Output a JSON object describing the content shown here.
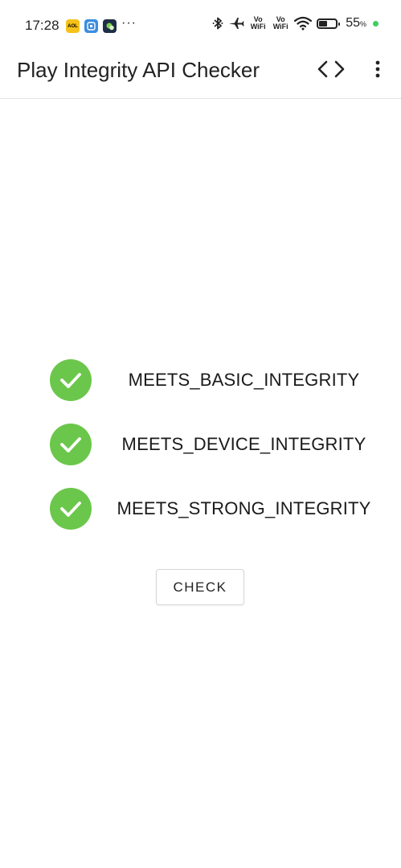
{
  "status_bar": {
    "time": "17:28",
    "apps": [
      {
        "icon": "aol-app-icon",
        "label": "AOL"
      },
      {
        "icon": "blue-app-icon"
      },
      {
        "icon": "chat-app-icon"
      }
    ],
    "more_indicator": "···",
    "icons": [
      "bluetooth-icon",
      "airplane-mode-icon",
      "vowifi-icon",
      "vowifi-icon",
      "wifi-icon",
      "battery-icon"
    ],
    "vowifi_1": "Vo WiFi",
    "vowifi_2": "Vo WiFi",
    "battery_level": 55,
    "battery_text": "55",
    "battery_unit": "%",
    "status_dot_color": "#3ecf5c"
  },
  "app_bar": {
    "title": "Play Integrity API Checker",
    "actions": [
      "code-icon",
      "more-vert-icon"
    ]
  },
  "checks": [
    {
      "label": "MEETS_BASIC_INTEGRITY",
      "passed": true
    },
    {
      "label": "MEETS_DEVICE_INTEGRITY",
      "passed": true
    },
    {
      "label": "MEETS_STRONG_INTEGRITY",
      "passed": true
    }
  ],
  "check_button": {
    "label": "CHECK"
  },
  "colors": {
    "pass_green": "#6bc74b",
    "text": "#1a1a1a",
    "divider": "#e2e2e2"
  }
}
